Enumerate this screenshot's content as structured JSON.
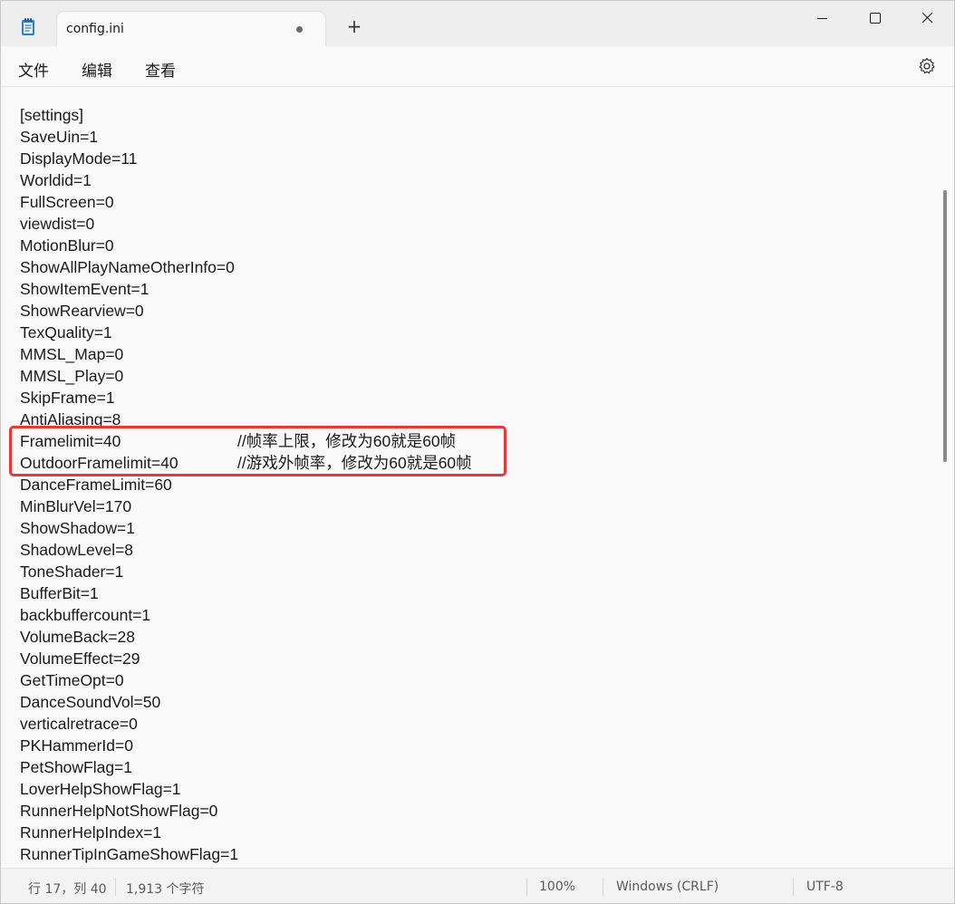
{
  "window": {
    "tab_title": "config.ini",
    "new_tab_icon": "+",
    "icons": [
      "notepad-icon",
      "unsaved-dot-icon",
      "minimize-icon",
      "maximize-icon",
      "close-icon",
      "settings-gear-icon"
    ]
  },
  "menu": {
    "file": "文件",
    "edit": "编辑",
    "view": "查看"
  },
  "editor": {
    "lines": [
      "[settings]",
      "SaveUin=1",
      "DisplayMode=11",
      "Worldid=1",
      "FullScreen=0",
      "viewdist=0",
      "MotionBlur=0",
      "ShowAllPlayNameOtherInfo=0",
      "ShowItemEvent=1",
      "ShowRearview=0",
      "TexQuality=1",
      "MMSL_Map=0",
      "MMSL_Play=0",
      "SkipFrame=1",
      "AntiAliasing=8",
      "Framelimit=40",
      "OutdoorFramelimit=40",
      "DanceFrameLimit=60",
      "MinBlurVel=170",
      "ShowShadow=1",
      "ShadowLevel=8",
      "ToneShader=1",
      "BufferBit=1",
      "backbuffercount=1",
      "VolumeBack=28",
      "VolumeEffect=29",
      "GetTimeOpt=0",
      "DanceSoundVol=50",
      "verticalretrace=0",
      "PKHammerId=0",
      "PetShowFlag=1",
      "LoverHelpShowFlag=1",
      "RunnerHelpNotShowFlag=0",
      "RunnerHelpIndex=1",
      "RunnerTipInGameShowFlag=1"
    ],
    "comment_framelimit": "//帧率上限，修改为60就是60帧",
    "comment_outdoor": "//游戏外帧率，修改为60就是60帧",
    "highlight_color": "#e53935"
  },
  "status": {
    "position": "行 17，列 40",
    "chars": "1,913 个字符",
    "zoom": "100%",
    "line_ending": "Windows (CRLF)",
    "encoding": "UTF-8"
  }
}
